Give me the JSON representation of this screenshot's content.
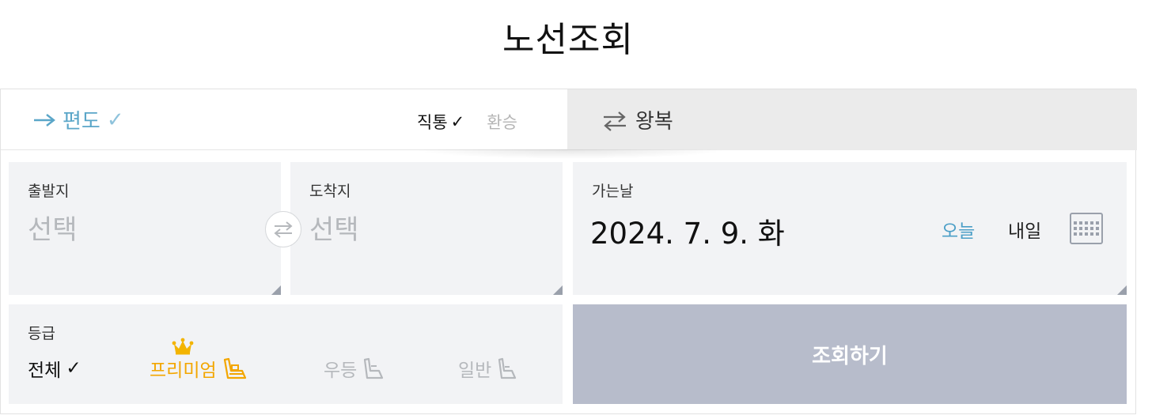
{
  "page": {
    "title": "노선조회"
  },
  "trip_type": {
    "oneway_label": "편도",
    "oneway_check": "✓",
    "direct_label": "직통",
    "direct_check": "✓",
    "transfer_label": "환승",
    "roundtrip_label": "왕복"
  },
  "departure": {
    "label": "출발지",
    "placeholder": "선택"
  },
  "arrival": {
    "label": "도착지",
    "placeholder": "선택"
  },
  "date": {
    "label": "가는날",
    "value": "2024. 7. 9. 화",
    "today_label": "오늘",
    "tomorrow_label": "내일"
  },
  "grade": {
    "label": "등급",
    "items": [
      {
        "label": "전체",
        "check": "✓"
      },
      {
        "label": "프리미엄"
      },
      {
        "label": "우등"
      },
      {
        "label": "일반"
      }
    ]
  },
  "search": {
    "label": "조회하기"
  },
  "colors": {
    "accent": "#5aa6c8",
    "premium": "#f3a600",
    "disabled": "#b5b8bc",
    "search_bg": "#b7bccb",
    "box_bg": "#f2f3f5"
  },
  "icons": {
    "oneway": "arrow-right-icon",
    "roundtrip": "swap-arrows-icon",
    "swap": "swap-arrows-icon",
    "calendar": "calendar-icon",
    "crown": "crown-icon",
    "seat": "seat-icon"
  }
}
